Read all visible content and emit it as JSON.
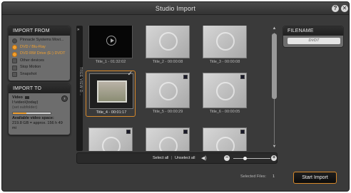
{
  "window": {
    "title": "Studio Import"
  },
  "titlebar": {
    "help_icon": "?",
    "close_icon": "✕"
  },
  "import_from": {
    "header": "IMPORT FROM",
    "items": [
      {
        "label": "Pinnacle Systems Movi...",
        "icon": "device-icon",
        "active": false
      },
      {
        "label": "DVD / Blu-Ray",
        "icon": "disc-icon",
        "active": true
      },
      {
        "label": "DVD RW Drive (E:) DVDT",
        "icon": "disc-drive-icon",
        "active": true
      },
      {
        "label": "Other devices",
        "icon": "device-icon",
        "active": false
      },
      {
        "label": "Stop Motion",
        "icon": "camera-icon",
        "active": false
      },
      {
        "label": "Snapshot",
        "icon": "snapshot-icon",
        "active": false
      }
    ]
  },
  "import_to": {
    "header": "IMPORT TO",
    "video_label": "Video",
    "path": "I:\\video\\(today)",
    "subfolder": "(set subfolder)",
    "available_label": "Available video space:",
    "available_value": "219.8 GB = approx. 156 h 49 mi",
    "space_used_fraction": 0.35
  },
  "tree_view": {
    "label": "TREE VIEW D..."
  },
  "grid": {
    "tiles": [
      {
        "label": "Title_1 - 01:32:02",
        "style": "dark"
      },
      {
        "label": "Title_2 - 00:00:08",
        "style": "gray"
      },
      {
        "label": "Title_3 - 00:00:08",
        "style": "gray"
      },
      {
        "label": "Title_4 - 00:01:17",
        "style": "photo",
        "selected": true
      },
      {
        "label": "Title_5 - 00:00:29",
        "style": "gray"
      },
      {
        "label": "Title_6 - 00:00:05",
        "style": "gray"
      },
      {
        "label": "",
        "style": "gray"
      },
      {
        "label": "",
        "style": "gray"
      },
      {
        "label": "",
        "style": "gray"
      }
    ]
  },
  "bottom_bar": {
    "select_all": "Select all",
    "separator": "|",
    "unselect_all": "Unselect all",
    "zoom_fraction": 0.3
  },
  "filename": {
    "header": "FILENAME",
    "value": "DVDT"
  },
  "footer": {
    "selected_files_label": "Selected Files:",
    "selected_files_count": "1",
    "start_button": "Start Import"
  }
}
